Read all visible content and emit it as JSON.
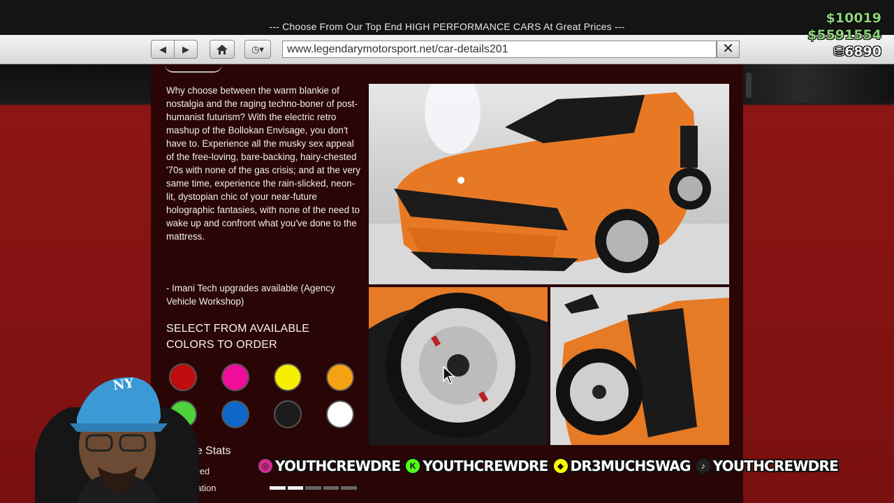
{
  "header": {
    "slogan": "--- Choose From Our Top End HIGH PERFORMANCE CARS At Great Prices ---"
  },
  "browser": {
    "url": "www.legendarymotorsport.net/car-details201",
    "back_icon": "back-arrow-icon",
    "forward_icon": "forward-arrow-icon",
    "home_icon": "home-icon",
    "history_icon": "clock-icon",
    "close_icon": "close-x-icon",
    "history_glyph": "◷▾",
    "close_glyph": "✕"
  },
  "hud": {
    "cash": "$10019",
    "bank": "$5591554",
    "chips": "6890",
    "chips_icon": "chips-icon",
    "chips_glyph": "⛁"
  },
  "listing": {
    "description": "Why choose between the warm blankie of nostalgia and the raging techno-boner of post-humanist futurism? With the electric retro mashup of the Bollokan Envisage, you don't have to. Experience all the musky sex appeal of the free-loving, bare-backing, hairy-chested '70s with none of the gas crisis; and at the very same time, experience the rain-slicked, neon-lit, dystopian chic of your near-future holographic fantasies, with none of the need to wake up and confront what you've done to the mattress.",
    "upgrade_note": "- Imani Tech upgrades available (Agency Vehicle Workshop)",
    "colors_heading": "SELECT FROM AVAILABLE COLORS TO ORDER",
    "colors": [
      {
        "name": "red",
        "hex": "#c00c0c"
      },
      {
        "name": "pink",
        "hex": "#f00d9a"
      },
      {
        "name": "yellow",
        "hex": "#f6f000"
      },
      {
        "name": "orange",
        "hex": "#f4a212"
      },
      {
        "name": "green",
        "hex": "#4ed33c"
      },
      {
        "name": "blue",
        "hex": "#0d67c9"
      },
      {
        "name": "black",
        "hex": "#1c1c1c"
      },
      {
        "name": "white",
        "hex": "#ffffff"
      }
    ],
    "stats_heading": "Vehicle Stats",
    "stats": [
      {
        "label": "Top Speed"
      },
      {
        "label": "Acceleration",
        "filled_fraction": 0.35
      }
    ]
  },
  "social": [
    {
      "platform": "instagram",
      "icon": "instagram-icon",
      "glyph": "◎",
      "handle": "YOUTHCREWDRE",
      "color": "#d12d8c"
    },
    {
      "platform": "kick",
      "icon": "kick-icon",
      "glyph": "K",
      "handle": "YOUTHCREWDRE",
      "color": "#53fc18"
    },
    {
      "platform": "snapchat",
      "icon": "snapchat-icon",
      "glyph": "◆",
      "handle": "DR3MUCHSWAG",
      "color": "#fffc00"
    },
    {
      "platform": "tiktok",
      "icon": "tiktok-icon",
      "glyph": "♪",
      "handle": "YOUTHCREWDRE",
      "color": "#222222"
    }
  ],
  "webcam": {
    "cap_text": "NY"
  }
}
